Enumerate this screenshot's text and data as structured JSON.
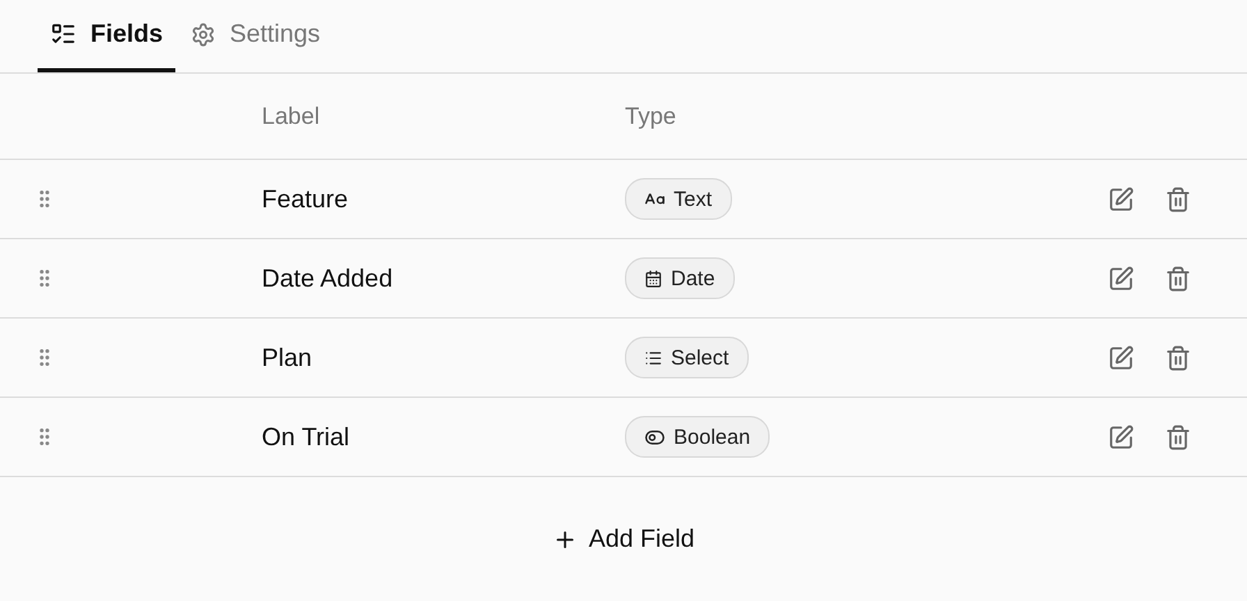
{
  "tabs": [
    {
      "label": "Fields",
      "kind": "fields",
      "selected": true
    },
    {
      "label": "Settings",
      "kind": "settings",
      "selected": false
    }
  ],
  "table": {
    "columns": [
      "Label",
      "Type"
    ],
    "rows": [
      {
        "label": "Feature",
        "type": {
          "kind": "text",
          "label": "Text"
        }
      },
      {
        "label": "Date Added",
        "type": {
          "kind": "date",
          "label": "Date"
        }
      },
      {
        "label": "Plan",
        "type": {
          "kind": "select",
          "label": "Select"
        }
      },
      {
        "label": "On Trial",
        "type": {
          "kind": "boolean",
          "label": "Boolean"
        }
      }
    ]
  },
  "add_button": {
    "label": "Add Field"
  }
}
